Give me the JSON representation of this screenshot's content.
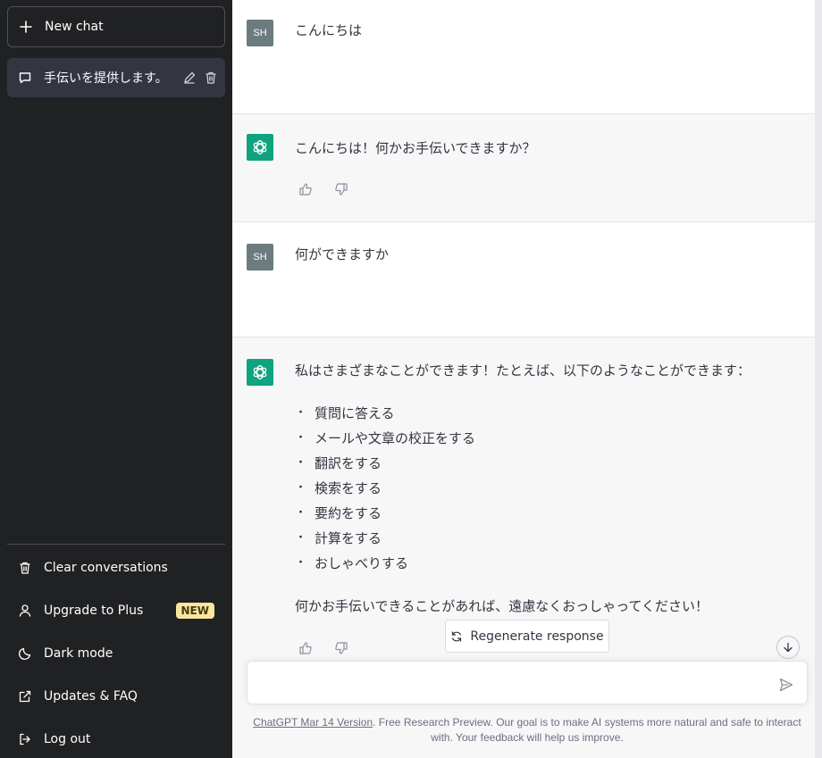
{
  "sidebar": {
    "new_chat_label": "New chat",
    "conversations": [
      {
        "label": "手伝いを提供します。"
      }
    ],
    "menu": {
      "clear": "Clear conversations",
      "upgrade": "Upgrade to Plus",
      "upgrade_badge": "NEW",
      "dark_mode": "Dark mode",
      "updates": "Updates & FAQ",
      "logout": "Log out"
    }
  },
  "messages": [
    {
      "role": "user",
      "avatar": "SH",
      "text": "こんにちは"
    },
    {
      "role": "assistant",
      "text": "こんにちは！何かお手伝いできますか？"
    },
    {
      "role": "user",
      "avatar": "SH",
      "text": "何ができますか"
    },
    {
      "role": "assistant",
      "intro": "私はさまざまなことができます！たとえば、以下のようなことができます：",
      "bullets": [
        "質問に答える",
        "メールや文章の校正をする",
        "翻訳をする",
        "検索をする",
        "要約をする",
        "計算をする",
        "おしゃべりする"
      ],
      "closing": "何かお手伝いできることがあれば、遠慮なくおっしゃってください！"
    }
  ],
  "regenerate_label": "Regenerate response",
  "input": {
    "placeholder": ""
  },
  "footer": {
    "version_link": "ChatGPT Mar 14 Version",
    "text": ". Free Research Preview. Our goal is to make AI systems more natural and safe to interact with. Your feedback will help us improve."
  },
  "colors": {
    "sidebar_bg": "#202123",
    "accent": "#10a37f",
    "badge_bg": "#fae69e"
  }
}
